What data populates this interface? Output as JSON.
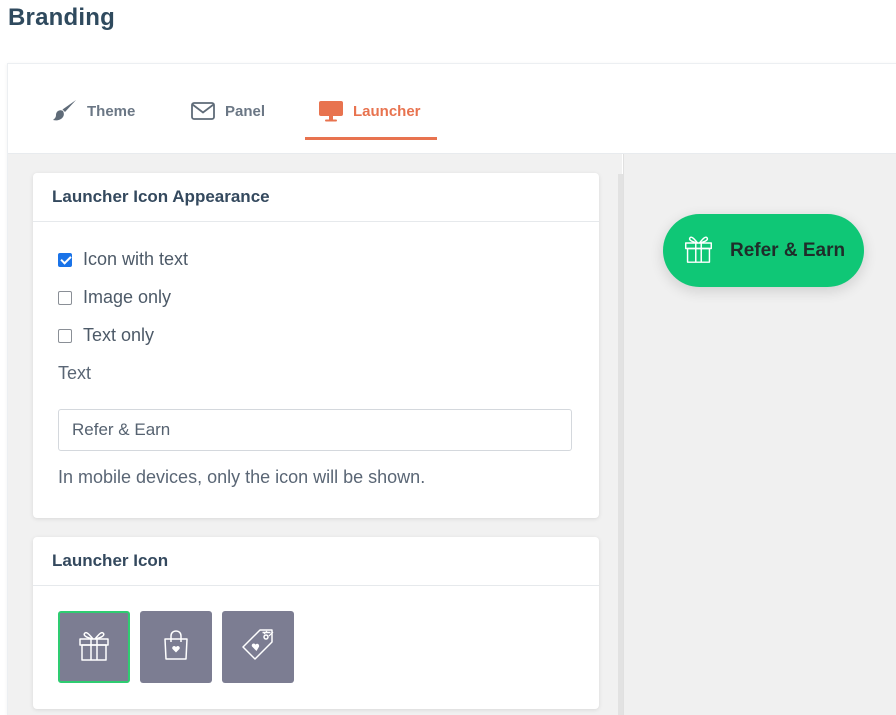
{
  "page": {
    "title": "Branding"
  },
  "tabs": [
    {
      "label": "Theme",
      "icon": "paintbrush-icon",
      "active": false
    },
    {
      "label": "Panel",
      "icon": "envelope-icon",
      "active": false
    },
    {
      "label": "Launcher",
      "icon": "monitor-icon",
      "active": true
    }
  ],
  "appearance": {
    "title": "Launcher Icon Appearance",
    "options": [
      {
        "label": "Icon with text",
        "checked": true
      },
      {
        "label": "Image only",
        "checked": false
      },
      {
        "label": "Text only",
        "checked": false
      }
    ],
    "text_label": "Text",
    "text_value": "Refer & Earn",
    "help": "In mobile devices, only the icon will be shown."
  },
  "launcher_icon": {
    "title": "Launcher Icon",
    "icons": [
      {
        "name": "gift-icon",
        "selected": true
      },
      {
        "name": "shopping-bag-icon",
        "selected": false
      },
      {
        "name": "price-tag-icon",
        "selected": false
      }
    ]
  },
  "preview": {
    "label": "Refer & Earn",
    "icon": "gift-icon"
  },
  "colors": {
    "accent": "#e8734f",
    "launcher_bg": "#0fc776",
    "tile_bg": "#7c7d92",
    "selected_border": "#2ecc71",
    "checkbox": "#1a73e8"
  }
}
